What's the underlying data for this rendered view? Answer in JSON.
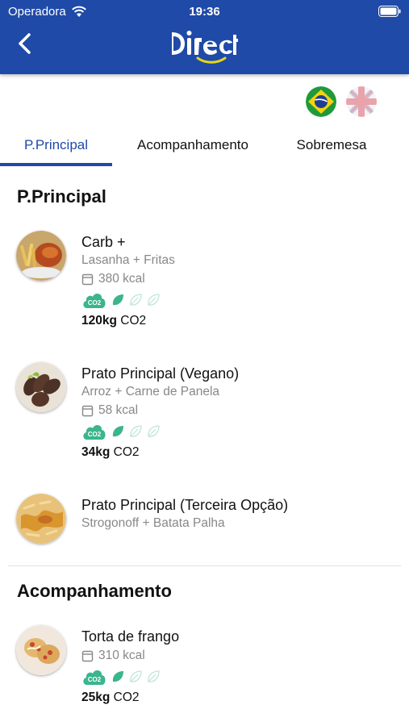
{
  "status_bar": {
    "carrier": "Operadora",
    "time": "19:36"
  },
  "header": {
    "logo_text": "Direct"
  },
  "colors": {
    "primary": "#1f4aa8",
    "eco_green": "#3bb58e",
    "eco_light": "#bfe6d6"
  },
  "tabs": [
    {
      "label": "P.Principal",
      "active": true
    },
    {
      "label": "Acompanhamento",
      "active": false
    },
    {
      "label": "Sobremesa",
      "active": false
    }
  ],
  "sections": [
    {
      "title": "P.Principal",
      "items": [
        {
          "name": "Carb +",
          "description": "Lasanha + Fritas",
          "kcal": "380 kcal",
          "co2_value": "120kg",
          "co2_unit": "CO2",
          "leaf_rating": 1
        },
        {
          "name": "Prato Principal (Vegano)",
          "description": "Arroz + Carne de Panela",
          "kcal": "58 kcal",
          "co2_value": "34kg",
          "co2_unit": "CO2",
          "leaf_rating": 1
        },
        {
          "name": "Prato Principal (Terceira Opção)",
          "description": "Strogonoff + Batata Palha"
        }
      ]
    },
    {
      "title": "Acompanhamento",
      "items": [
        {
          "name": "Torta de frango",
          "kcal": "310 kcal",
          "co2_value": "25kg",
          "co2_unit": "CO2",
          "leaf_rating": 1
        }
      ]
    }
  ]
}
